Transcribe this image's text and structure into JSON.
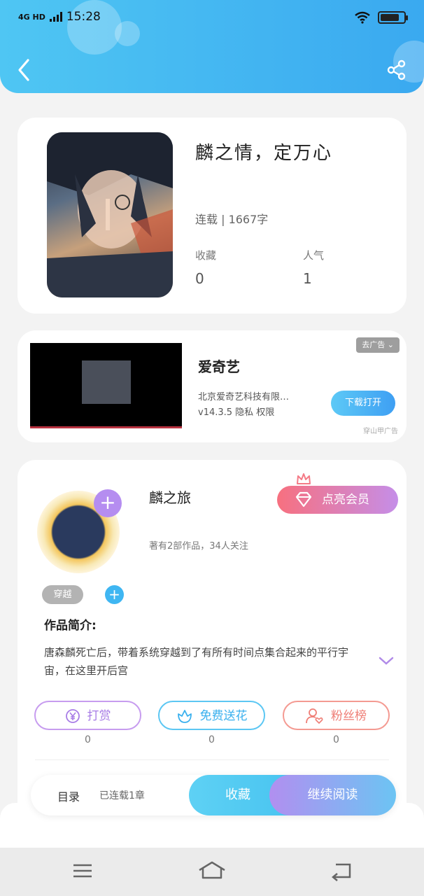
{
  "status_bar": {
    "network": "4G HD",
    "time": "15:28"
  },
  "header": {
    "back_icon": "chevron-left-icon",
    "share_icon": "share-icon"
  },
  "book": {
    "title": "麟之情，定万心",
    "status": "连载 | 1667字",
    "favorites_label": "收藏",
    "favorites_value": "0",
    "popularity_label": "人气",
    "popularity_value": "1"
  },
  "ad": {
    "badge": "去广告 ⌄",
    "app_name": "爱奇艺",
    "company": "北京爱奇艺科技有限…",
    "meta": "v14.3.5 隐私 权限",
    "button": "下载打开",
    "source": "穿山甲广告"
  },
  "author": {
    "name": "麟之旅",
    "vip_button": "点亮会员",
    "stats": "著有2部作品，34人关注",
    "tag": "穿越",
    "intro_label": "作品简介:",
    "intro_text": "唐森麟死亡后，带着系统穿越到了有所有时间点集合起来的平行宇宙，在这里开后宫",
    "actions": [
      {
        "label": "打赏",
        "count": "0"
      },
      {
        "label": "免费送花",
        "count": "0"
      },
      {
        "label": "粉丝榜",
        "count": "0"
      }
    ]
  },
  "action_bar": {
    "toc": "目录",
    "toc_status": "已连载1章",
    "collect": "收藏",
    "continue": "继续阅读"
  },
  "colors": {
    "header": "#3fb1f1",
    "vip": "#f7707f",
    "purple": "#b58df0",
    "blue": "#3fb6f2"
  }
}
